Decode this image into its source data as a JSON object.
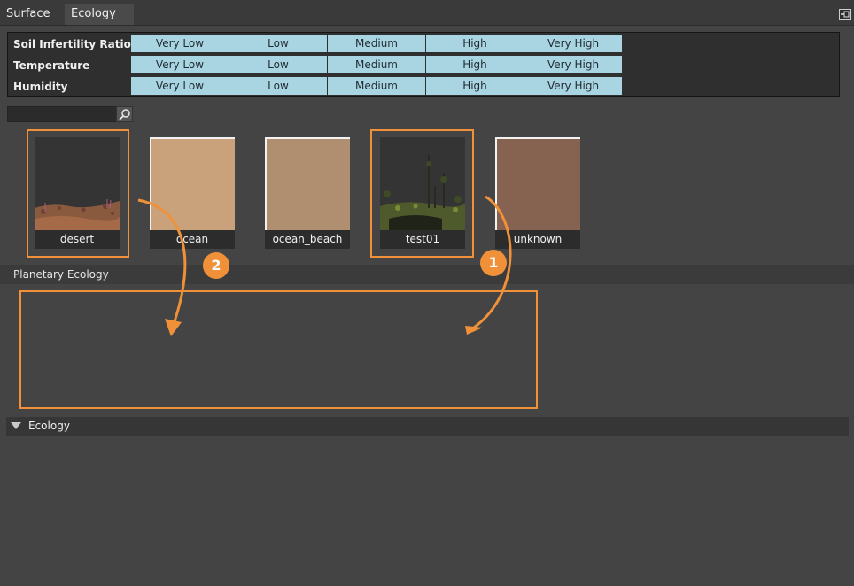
{
  "tabs": [
    {
      "label": "Surface"
    },
    {
      "label": "Ecology"
    }
  ],
  "range_table": {
    "rows": [
      {
        "label": "Soil Infertility Ratio",
        "levels": [
          "Very Low",
          "Low",
          "Medium",
          "High",
          "Very High"
        ]
      },
      {
        "label": "Temperature",
        "levels": [
          "Very Low",
          "Low",
          "Medium",
          "High",
          "Very High"
        ]
      },
      {
        "label": "Humidity",
        "levels": [
          "Very Low",
          "Low",
          "Medium",
          "High",
          "Very High"
        ]
      }
    ]
  },
  "search": {
    "value": "",
    "icon": "search-icon"
  },
  "tiles": [
    {
      "label": "desert"
    },
    {
      "label": "ocean"
    },
    {
      "label": "ocean_beach"
    },
    {
      "label": "test01"
    },
    {
      "label": "unknown"
    }
  ],
  "planetary_ecology": {
    "title": "Planetary Ecology"
  },
  "ecology_section": {
    "title": "Ecology",
    "icon": "triangle-down-icon"
  },
  "annotations": {
    "badge_1": "1",
    "badge_2": "2",
    "accent": "#f0913a"
  },
  "colors": {
    "level_cell": "#a9d5e3",
    "background": "#444444"
  }
}
